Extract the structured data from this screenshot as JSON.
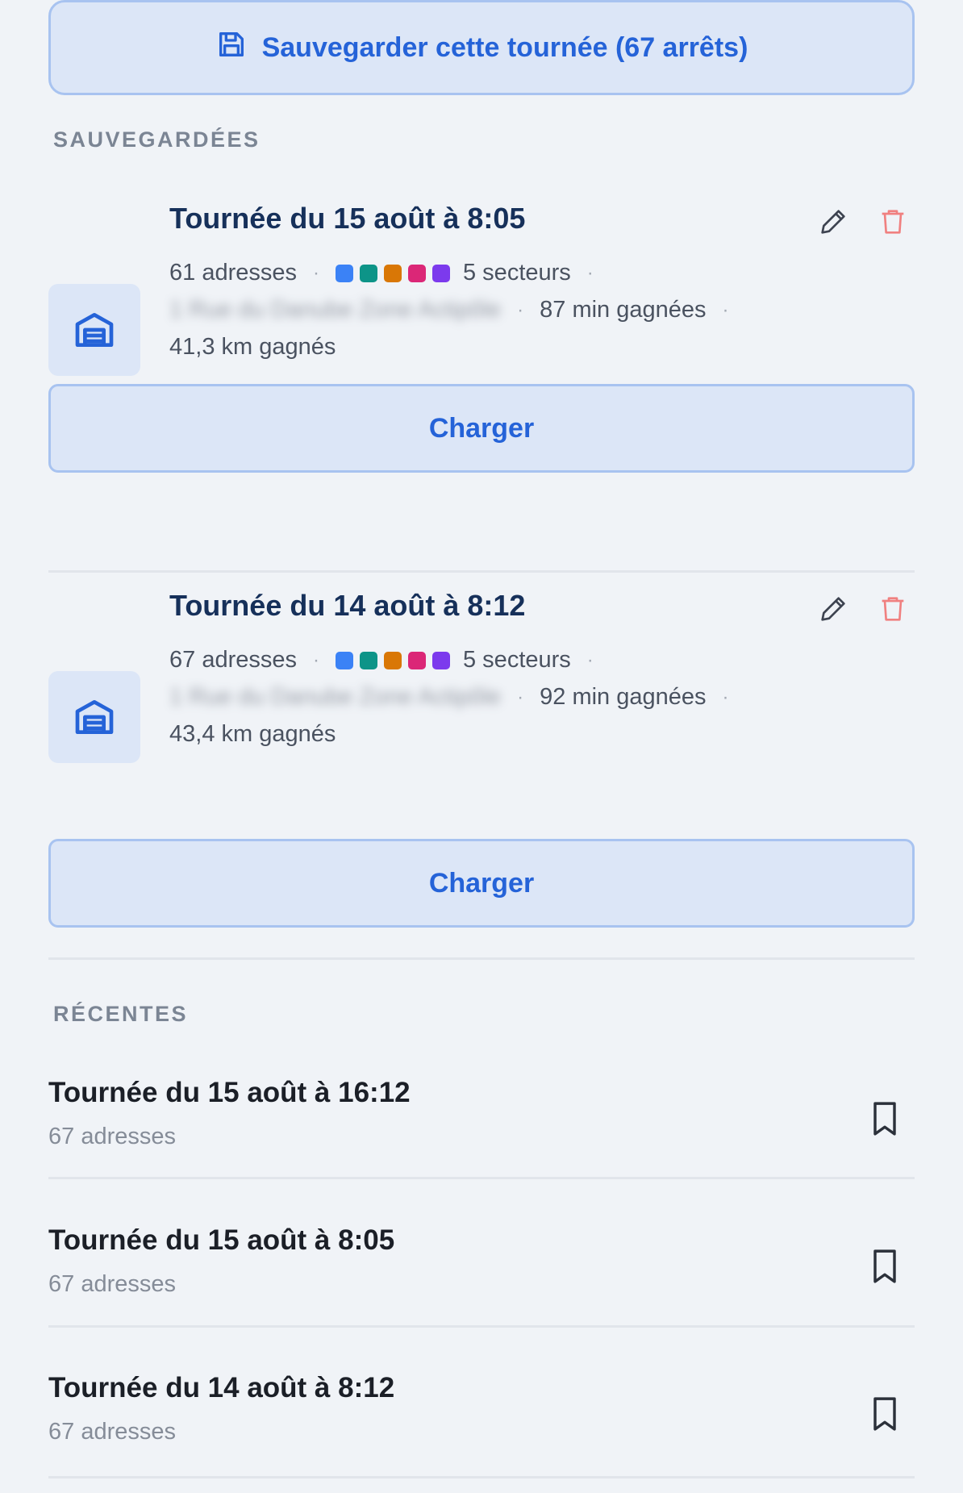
{
  "save_button": {
    "label": "Sauvegarder cette tournée (67 arrêts)"
  },
  "sections": {
    "saved_title": "SAUVEGARDÉES",
    "recent_title": "RÉCENTES"
  },
  "saved": [
    {
      "title": "Tournée du 15 août à 8:05",
      "addresses": "61 adresses",
      "sectors": "5 secteurs",
      "sector_colors": [
        "#3b82f6",
        "#0d9488",
        "#d97706",
        "#db2777",
        "#7c3aed"
      ],
      "address_blurred": "1 Rue du Danube Zone Actipôle",
      "time_saved": "87 min gagnées",
      "distance_saved": "41,3 km gagnés",
      "load_label": "Charger"
    },
    {
      "title": "Tournée du 14 août à 8:12",
      "addresses": "67 adresses",
      "sectors": "5 secteurs",
      "sector_colors": [
        "#3b82f6",
        "#0d9488",
        "#d97706",
        "#db2777",
        "#7c3aed"
      ],
      "address_blurred": "1 Rue du Danube Zone Actipôle",
      "time_saved": "92 min gagnées",
      "distance_saved": "43,4 km gagnés",
      "load_label": "Charger"
    }
  ],
  "recent": [
    {
      "title": "Tournée du 15 août à 16:12",
      "addresses": "67 adresses"
    },
    {
      "title": "Tournée du 15 août à 8:05",
      "addresses": "67 adresses"
    },
    {
      "title": "Tournée du 14 août à 8:12",
      "addresses": "67 adresses"
    }
  ],
  "icons": {
    "save": "floppy-disk-icon",
    "thumb": "warehouse-icon",
    "edit": "pencil-icon",
    "delete": "trash-icon",
    "bookmark": "bookmark-icon"
  },
  "colors": {
    "accent": "#2563d8",
    "delete": "#f08080",
    "title": "#16305a"
  }
}
